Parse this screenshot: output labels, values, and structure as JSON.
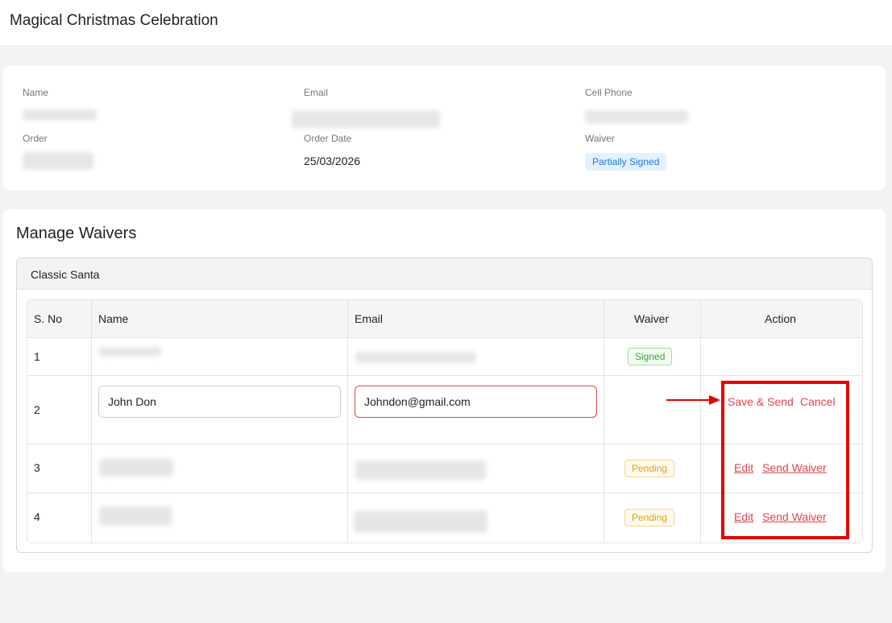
{
  "page": {
    "title": "Magical Christmas Celebration"
  },
  "customer": {
    "name_label": "Name",
    "email_label": "Email",
    "phone_label": "Cell Phone",
    "order_label": "Order",
    "order_date_label": "Order Date",
    "order_date": "25/03/2026",
    "waiver_label": "Waiver",
    "waiver_status": "Partially Signed"
  },
  "manage": {
    "title": "Manage Waivers",
    "product": "Classic Santa",
    "columns": [
      "S. No",
      "Name",
      "Email",
      "Waiver",
      "Action"
    ],
    "rows": [
      {
        "sno": "1",
        "waiver": "Signed"
      },
      {
        "sno": "2",
        "name_value": "John Don",
        "email_value": "Johndon@gmail.com",
        "save_label": "Save & Send",
        "cancel_label": "Cancel"
      },
      {
        "sno": "3",
        "waiver": "Pending",
        "edit_label": "Edit",
        "send_label": "Send Waiver"
      },
      {
        "sno": "4",
        "waiver": "Pending",
        "edit_label": "Edit",
        "send_label": "Send Waiver"
      }
    ]
  },
  "colors": {
    "accent": "#e3434a",
    "highlight": "#e60000",
    "signed": "#3ca53c",
    "pending": "#e0a11c",
    "partial": "#1e7ad6"
  },
  "icons": {
    "annotation": "arrow-right-icon"
  }
}
